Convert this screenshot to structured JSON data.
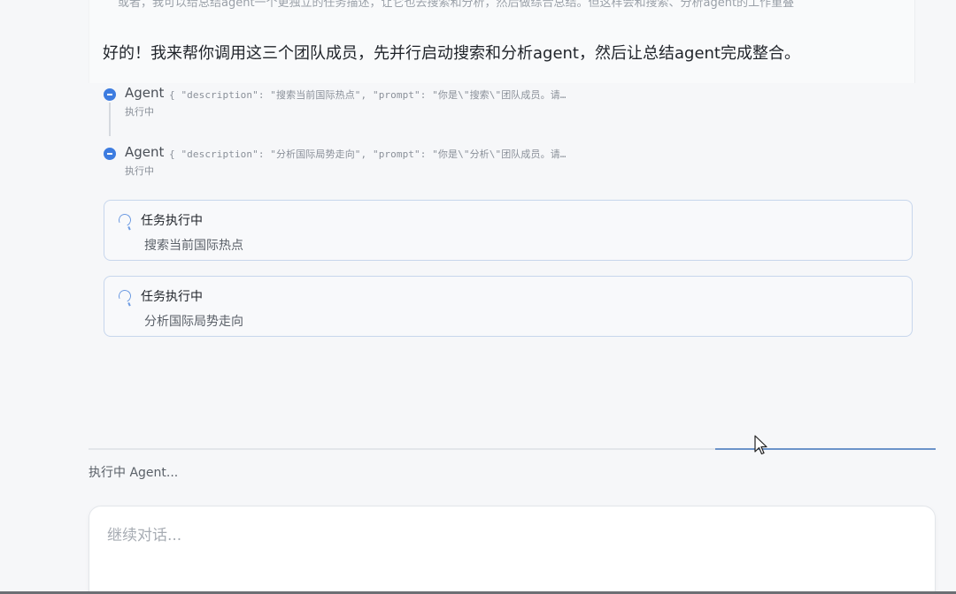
{
  "previous_message": {
    "text": "或者，我可以给总结agent一个更独立的任务描述，让它也去搜索和分析，然后做综合总结。但这样会和搜索、分析agent的工作重叠"
  },
  "assistant": {
    "intro": "好的！我来帮你调用这三个团队成员，先并行启动搜索和分析agent，然后让总结agent完成整合。"
  },
  "tool_calls": [
    {
      "name": "Agent",
      "args": "{ \"description\": \"搜索当前国际热点\", \"prompt\": \"你是\\\"搜索\\\"团队成员。请…",
      "status": "执行中"
    },
    {
      "name": "Agent",
      "args": "{ \"description\": \"分析国际局势走向\", \"prompt\": \"你是\\\"分析\\\"团队成员。请…",
      "status": "执行中"
    }
  ],
  "tasks": [
    {
      "title": "任务执行中",
      "description": "搜索当前国际热点"
    },
    {
      "title": "任务执行中",
      "description": "分析国际局势走向"
    }
  ],
  "progress": {
    "start": 0.74,
    "end": 1.0
  },
  "status_bar": {
    "text": "执行中 Agent..."
  },
  "input": {
    "placeholder": "继续对话...",
    "value": ""
  },
  "colors": {
    "accent": "#3d7ce0",
    "card_border": "#c7d6ec",
    "progress": "#6b93c9"
  },
  "icons": {
    "tool_status": "minus-circle-icon",
    "task_status": "loading-spinner-icon",
    "pointer": "mouse-cursor-icon"
  }
}
